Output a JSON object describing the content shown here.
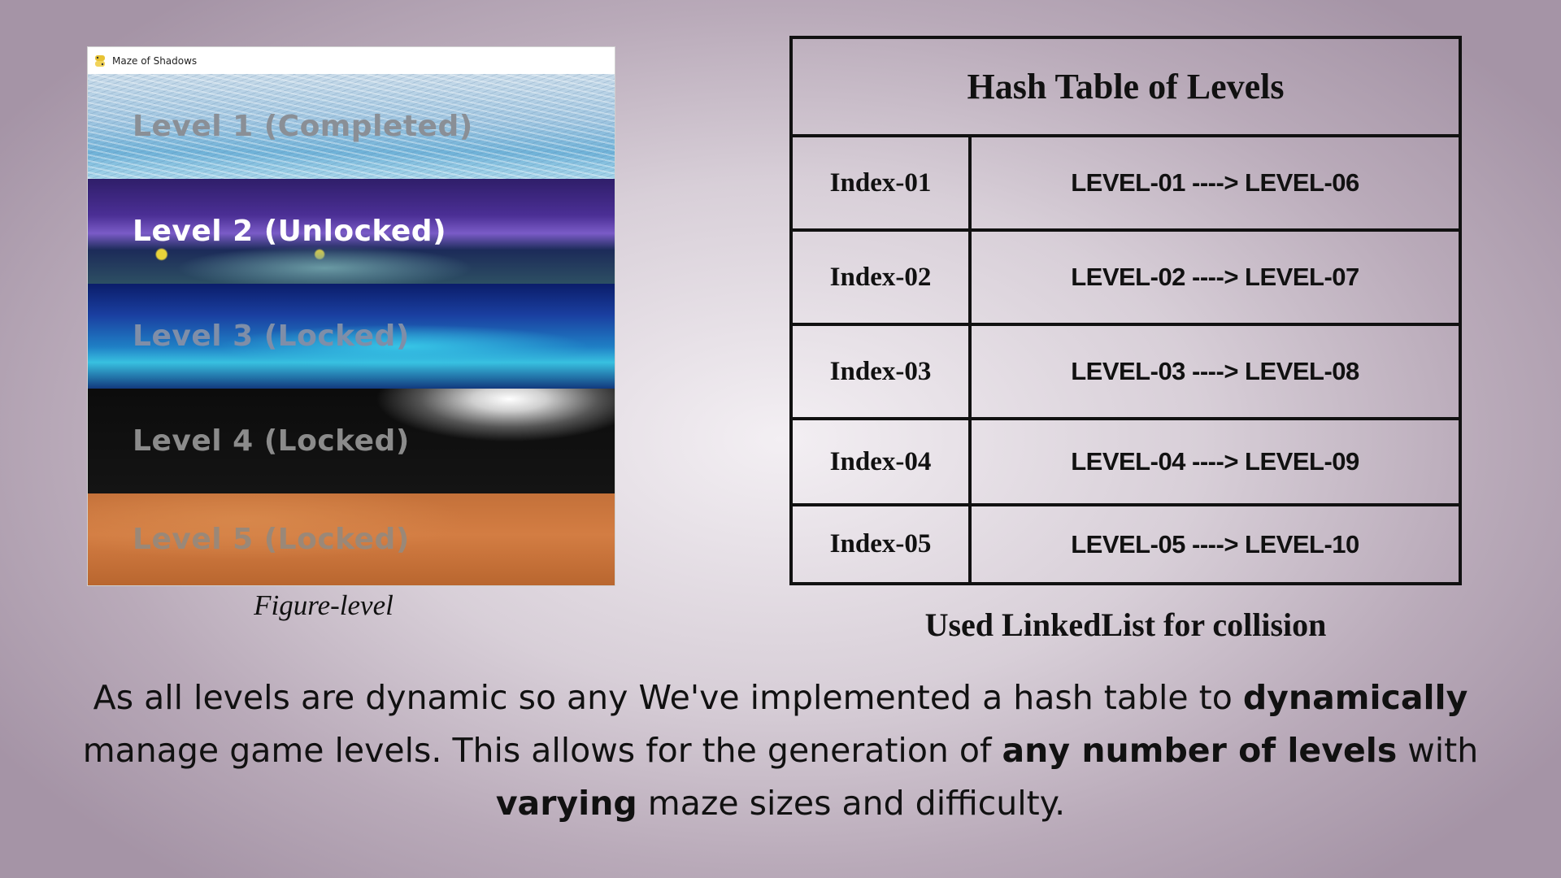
{
  "game_window": {
    "title": "Maze of Shadows",
    "levels": [
      {
        "label": "Level 1 (Completed)",
        "color": "#8a8f96"
      },
      {
        "label": "Level 2 (Unlocked)",
        "color": "#ffffff"
      },
      {
        "label": "Level 3 (Locked)",
        "color": "#7f8ea8"
      },
      {
        "label": "Level 4 (Locked)",
        "color": "#8b8b8b"
      },
      {
        "label": "Level 5 (Locked)",
        "color": "#9a8878"
      }
    ]
  },
  "figure_caption": "Figure-level",
  "hash_table": {
    "title": "Hash Table of Levels",
    "rows": [
      {
        "index": "Index-01",
        "chain": "LEVEL-01 ----> LEVEL-06"
      },
      {
        "index": "Index-02",
        "chain": "LEVEL-02 ----> LEVEL-07"
      },
      {
        "index": "Index-03",
        "chain": "LEVEL-03 ----> LEVEL-08"
      },
      {
        "index": "Index-04",
        "chain": "LEVEL-04 ----> LEVEL-09"
      },
      {
        "index": "Index-05",
        "chain": "LEVEL-05 ----> LEVEL-10"
      }
    ],
    "caption": "Used LinkedList for collision"
  },
  "description": {
    "p1": "As all levels are dynamic so any We've implemented a hash table to ",
    "b1": "dynamically",
    "p2": " manage game levels. This allows for the generation of ",
    "b2": "any number of levels",
    "p3": " with ",
    "b3": "varying",
    "p4": " maze sizes and difficulty."
  }
}
